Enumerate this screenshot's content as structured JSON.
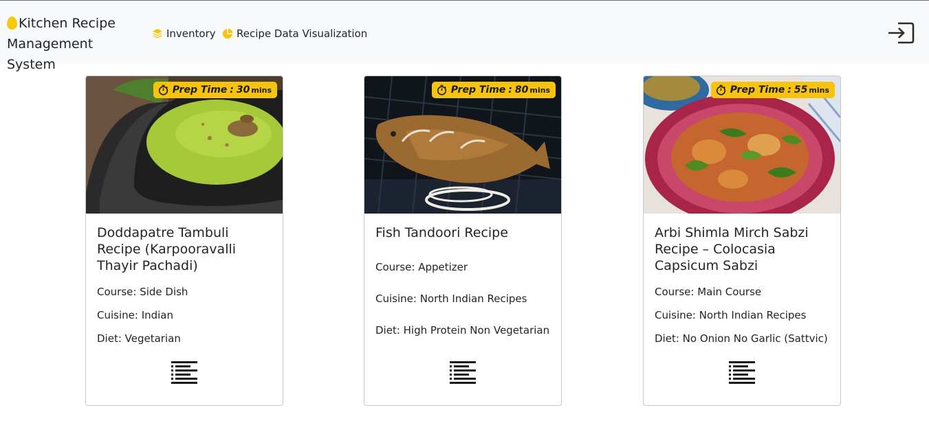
{
  "app": {
    "title": "Kitchen Recipe Management System"
  },
  "nav": {
    "inventory_label": "Inventory",
    "visualization_label": "Recipe Data Visualization"
  },
  "colors": {
    "accent": "#f6c40f",
    "navbar_bg": "#f8f9fa"
  },
  "icons": {
    "brand": "egg-icon",
    "inventory": "layers-icon",
    "visualization": "pie-chart-icon",
    "logout": "logout-icon",
    "prep_time": "stopwatch-icon",
    "view_recipe": "text-lines-icon"
  },
  "recipes": [
    {
      "prep_label": "Prep Time",
      "prep_time": "30",
      "prep_unit": "mins",
      "title": "Doddapatre Tambuli Recipe (Karpooravalli Thayir Pachadi)",
      "course": "Course: Side Dish",
      "cuisine": "Cuisine: Indian",
      "diet": "Diet: Vegetarian"
    },
    {
      "prep_label": "Prep Time",
      "prep_time": "80",
      "prep_unit": "mins",
      "title": "Fish Tandoori Recipe",
      "course": "Course: Appetizer",
      "cuisine": "Cuisine: North Indian Recipes",
      "diet": "Diet: High Protein Non Vegetarian"
    },
    {
      "prep_label": "Prep Time",
      "prep_time": "55",
      "prep_unit": "mins",
      "title": "Arbi Shimla Mirch Sabzi Recipe – Colocasia Capsicum Sabzi",
      "course": "Course: Main Course",
      "cuisine": "Cuisine: North Indian Recipes",
      "diet": "Diet: No Onion No Garlic (Sattvic)"
    }
  ]
}
